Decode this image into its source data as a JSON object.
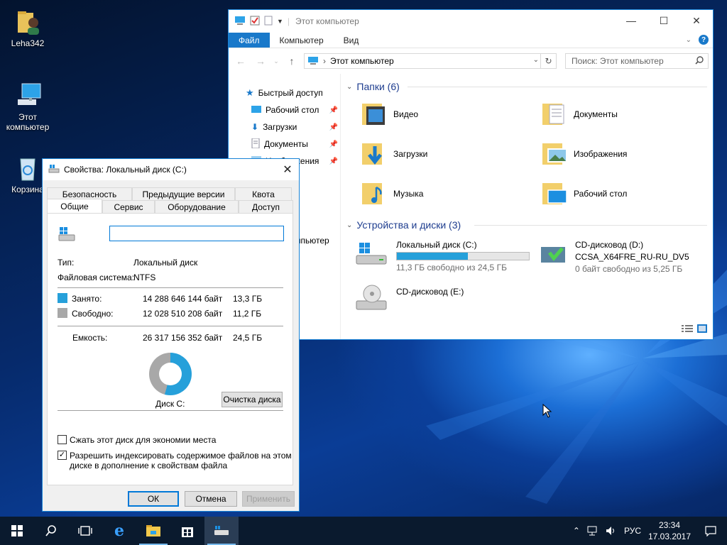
{
  "desktop": {
    "icons": [
      {
        "label": "Leha342"
      },
      {
        "label": "Этот компьютер"
      },
      {
        "label": "Корзина"
      }
    ]
  },
  "explorer": {
    "title": "Этот компьютер",
    "ribbon_tabs": [
      "Файл",
      "Компьютер",
      "Вид"
    ],
    "address": "Этот компьютер",
    "search_placeholder": "Поиск: Этот компьютер",
    "nav": {
      "quick_access": "Быстрый доступ",
      "items": [
        "Рабочий стол",
        "Загрузки",
        "Документы",
        "Изображения"
      ],
      "this_pc": "Этот компьютер"
    },
    "folders_header": "Папки (6)",
    "folders": [
      "Видео",
      "Документы",
      "Загрузки",
      "Изображения",
      "Музыка",
      "Рабочий стол"
    ],
    "devices_header": "Устройства и диски (3)",
    "drives": [
      {
        "name": "Локальный диск (C:)",
        "free_text": "11,3 ГБ свободно из 24,5 ГБ",
        "used_fraction": 0.54
      },
      {
        "name": "CD-дисковод (D:)",
        "label": "CCSA_X64FRE_RU-RU_DV5",
        "free_text": "0 байт свободно из 5,25 ГБ"
      },
      {
        "name": "CD-дисковод (E:)"
      }
    ]
  },
  "dialog": {
    "title": "Свойства: Локальный диск (C:)",
    "tabs_top": [
      "Безопасность",
      "Предыдущие версии",
      "Квота"
    ],
    "tabs_bottom": [
      "Общие",
      "Сервис",
      "Оборудование",
      "Доступ"
    ],
    "name_value": "",
    "type_label": "Тип:",
    "type_value": "Локальный диск",
    "fs_label": "Файловая система:",
    "fs_value": "NTFS",
    "used_label": "Занято:",
    "used_bytes": "14 288 646 144 байт",
    "used_gb": "13,3 ГБ",
    "free_label": "Свободно:",
    "free_bytes": "12 028 510 208 байт",
    "free_gb": "11,2 ГБ",
    "capacity_label": "Емкость:",
    "capacity_bytes": "26 317 156 352 байт",
    "capacity_gb": "24,5 ГБ",
    "disk_label": "Диск C:",
    "cleanup_button": "Очистка диска",
    "compress_label": "Сжать этот диск для экономии места",
    "compress_checked": false,
    "index_label_1": "Разрешить индексировать содержимое файлов на этом",
    "index_label_2": "диске в дополнение к свойствам файла",
    "index_checked": true,
    "ok": "ОК",
    "cancel": "Отмена",
    "apply": "Применить",
    "colors": {
      "used": "#26a0da",
      "free": "#a8a8a8"
    }
  },
  "taskbar": {
    "lang": "РУС",
    "time": "23:34",
    "date": "17.03.2017"
  }
}
